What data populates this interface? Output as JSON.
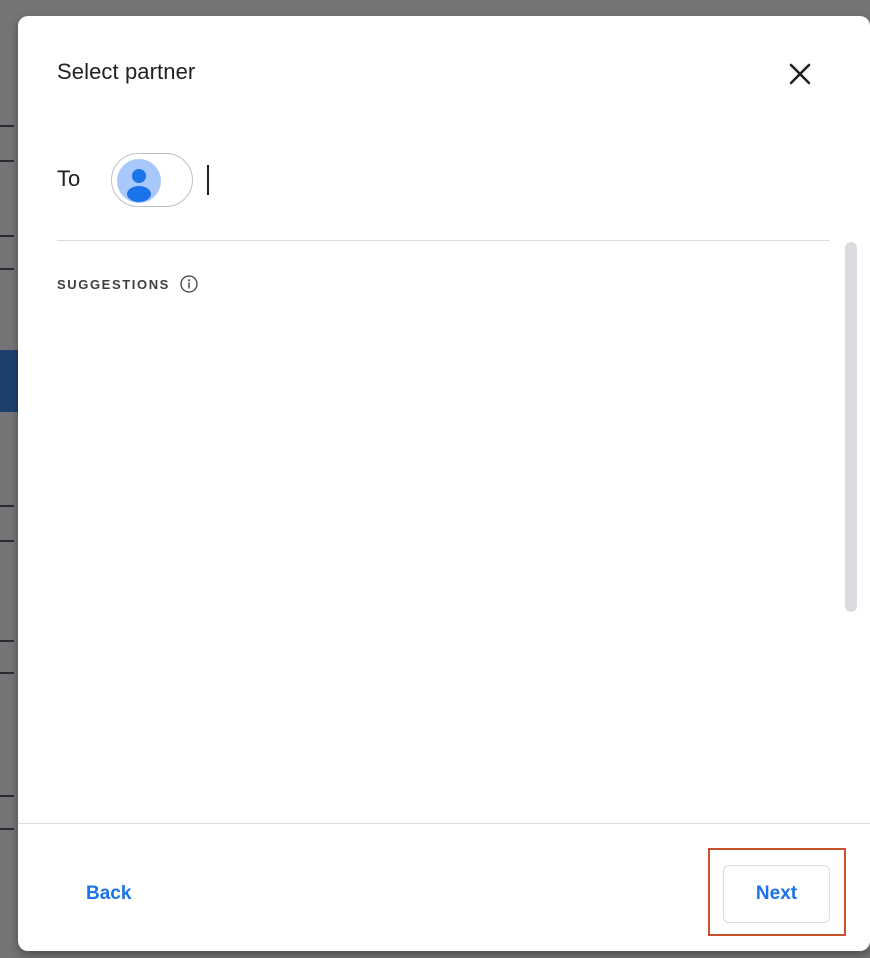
{
  "dialog": {
    "title": "Select partner",
    "to_label": "To",
    "suggestions_label": "SUGGESTIONS",
    "back_label": "Back",
    "next_label": "Next"
  },
  "icons": {
    "close": "close-icon",
    "avatar": "person-avatar-icon",
    "info": "info-icon"
  },
  "colors": {
    "accent": "#1a73e8",
    "avatar_bg": "#a8c7fa",
    "highlight": "#c8502a"
  }
}
